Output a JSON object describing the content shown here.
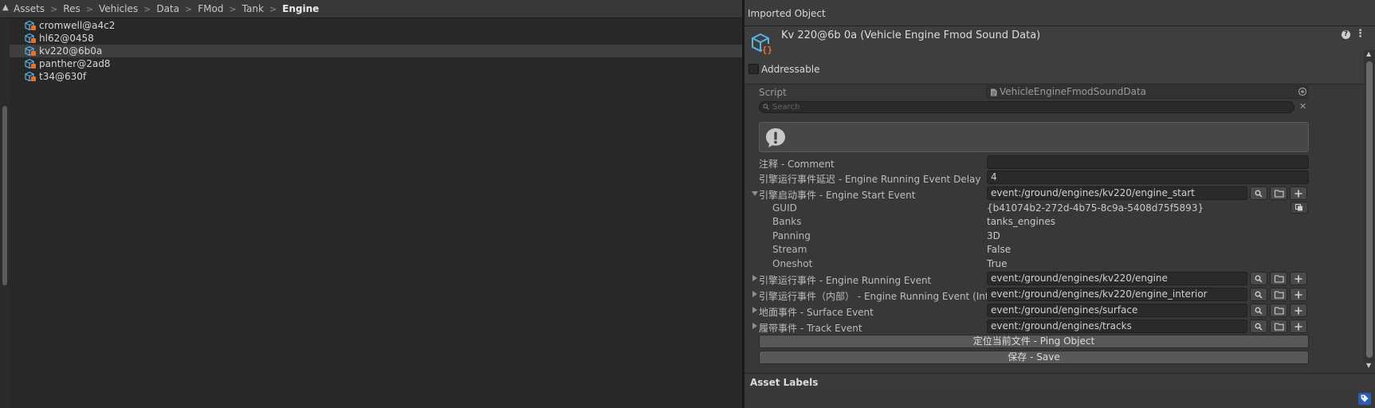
{
  "project": {
    "breadcrumb": [
      "Assets",
      "Res",
      "Vehicles",
      "Data",
      "FMod",
      "Tank",
      "Engine"
    ],
    "breadcrumb_separator": ">",
    "files": [
      "cromwell@a4c2",
      "hl62@0458",
      "kv220@6b0a",
      "panther@2ad8",
      "t34@630f"
    ],
    "selected_file": "kv220@6b0a"
  },
  "inspector": {
    "imported_header": "Imported Object",
    "object_title": "Kv 220@6b 0a (Vehicle Engine Fmod Sound Data)",
    "addressable_label": "Addressable",
    "script": {
      "label": "Script",
      "value": "VehicleEngineFmodSoundData"
    },
    "search_placeholder": "Search",
    "comment": {
      "label": "注释 - Comment",
      "value": ""
    },
    "delay": {
      "label": "引擎运行事件延迟 - Engine Running Event Delay",
      "value": "4"
    },
    "start_event": {
      "label": "引擎启动事件 - Engine Start Event",
      "value": "event:/ground/engines/kv220/engine_start",
      "details": [
        {
          "label": "GUID",
          "value": "{b41074b2-272d-4b75-8c9a-5408d75f5893}"
        },
        {
          "label": "Banks",
          "value": "tanks_engines"
        },
        {
          "label": "Panning",
          "value": "3D"
        },
        {
          "label": "Stream",
          "value": "False"
        },
        {
          "label": "Oneshot",
          "value": "True"
        }
      ]
    },
    "events": [
      {
        "label": "引擎运行事件 - Engine Running Event",
        "value": "event:/ground/engines/kv220/engine"
      },
      {
        "label": "引擎运行事件（内部） - Engine Running Event (Interior)",
        "value": "event:/ground/engines/kv220/engine_interior"
      },
      {
        "label": "地面事件 - Surface Event",
        "value": "event:/ground/engines/surface"
      },
      {
        "label": "履带事件 - Track Event",
        "value": "event:/ground/engines/tracks"
      }
    ],
    "ping_button": "定位当前文件 - Ping Object",
    "save_button": "保存 - Save",
    "asset_labels": "Asset Labels"
  },
  "colors": {
    "panel_bg": "#282828",
    "inspector_bg": "#383838",
    "field_bg": "#2a2a2a",
    "accent_blue": "#2a5db0",
    "icon_blue": "#5ab4e8",
    "icon_orange": "#e8702a"
  },
  "icons": {
    "file": "scriptable-object-icon",
    "script": "script-file-icon",
    "search": "magnifier-icon",
    "folder": "folder-icon",
    "add": "plus-icon",
    "warning": "exclamation-bubble-icon",
    "tag": "label-tag-icon"
  }
}
